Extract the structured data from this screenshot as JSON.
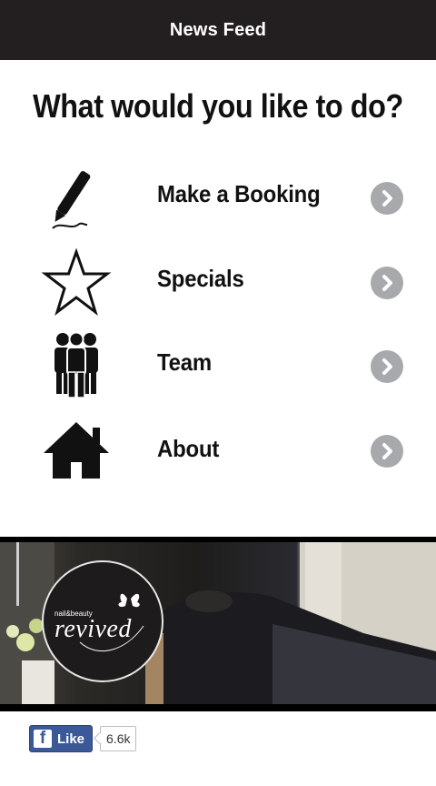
{
  "header": {
    "title": "News Feed"
  },
  "heading": "What would you like to do?",
  "menu": [
    {
      "label": "Make a Booking",
      "icon": "pen-icon"
    },
    {
      "label": "Specials",
      "icon": "star-icon"
    },
    {
      "label": "Team",
      "icon": "people-icon"
    },
    {
      "label": "About",
      "icon": "house-icon"
    }
  ],
  "banner": {
    "logo_text": "revived",
    "logo_subtext": "nail&beauty"
  },
  "facebook": {
    "like_label": "Like",
    "like_count": "6.6k"
  },
  "colors": {
    "topbar": "#231f20",
    "chevron": "#a7a9ac",
    "facebook": "#3b5998"
  }
}
